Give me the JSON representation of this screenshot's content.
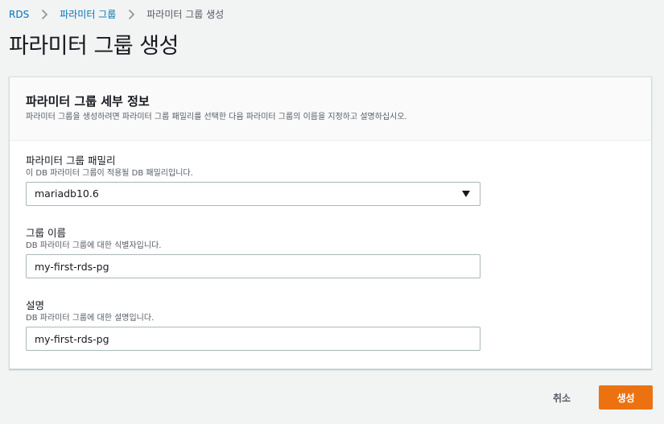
{
  "breadcrumb": {
    "items": [
      {
        "label": "RDS",
        "link": true
      },
      {
        "label": "파라미터 그룹",
        "link": true
      },
      {
        "label": "파라미터 그룹 생성",
        "link": false
      }
    ]
  },
  "page": {
    "title": "파라미터 그룹 생성"
  },
  "panel": {
    "title": "파라미터 그룹 세부 정보",
    "description": "파라미터 그룹을 생성하려면 파라미터 그룹 패밀리를 선택한 다음 파라미터 그룹의 이름을 지정하고 설명하십시오."
  },
  "fields": {
    "family": {
      "label": "파라미터 그룹 패밀리",
      "description": "이 DB 파라미터 그룹이 적용될 DB 패밀리입니다.",
      "value": "mariadb10.6"
    },
    "group_name": {
      "label": "그룹 이름",
      "description": "DB 파라미터 그룹에 대한 식별자입니다.",
      "value": "my-first-rds-pg"
    },
    "description": {
      "label": "설명",
      "description": "DB 파라미터 그룹에 대한 설명입니다.",
      "value": "my-first-rds-pg"
    }
  },
  "actions": {
    "cancel_label": "취소",
    "create_label": "생성"
  },
  "icons": {
    "breadcrumb_separator": "chevron-right-icon",
    "select_arrow": "caret-down-icon"
  },
  "colors": {
    "link": "#0073bb",
    "primary_button": "#ec7211",
    "background": "#f2f3f3"
  }
}
